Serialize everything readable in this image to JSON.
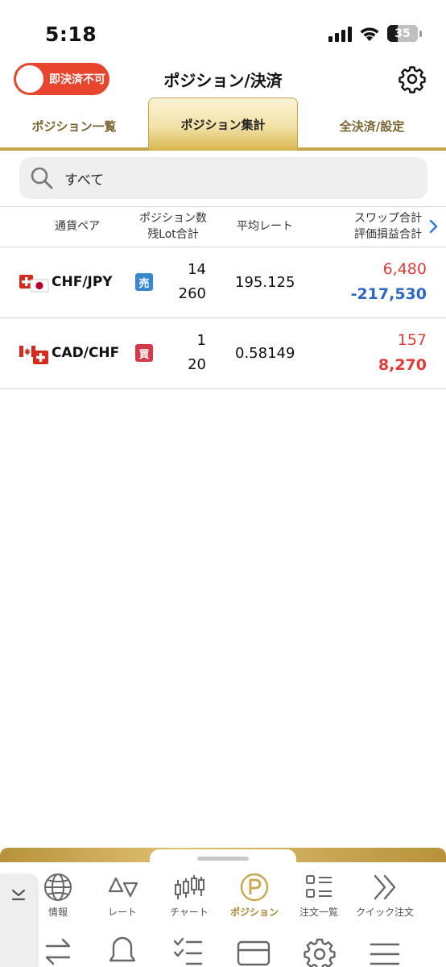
{
  "status_bar": {
    "time": "5:18",
    "battery": "35"
  },
  "header": {
    "toggle_label": "即決済不可",
    "title": "ポジション/決済"
  },
  "tabs": [
    {
      "label": "ポジション一覧",
      "active": false
    },
    {
      "label": "ポジション集計",
      "active": true
    },
    {
      "label": "全決済/設定",
      "active": false
    }
  ],
  "search": {
    "value": "すべて"
  },
  "table": {
    "headers": {
      "pair": "通貨ペア",
      "count_top": "ポジション数",
      "count_bottom": "残Lot合計",
      "rate": "平均レート",
      "swap_top": "スワップ合計",
      "swap_bottom": "評価損益合計"
    },
    "rows": [
      {
        "pair": "CHF/JPY",
        "side": "売",
        "side_color": "#3a87d0",
        "positions": "14",
        "lots": "260",
        "avg_rate": "195.125",
        "swap": "6,480",
        "swap_color": "#e23b36",
        "pnl": "-217,530",
        "pnl_color": "#2b66c9"
      },
      {
        "pair": "CAD/CHF",
        "side": "買",
        "side_color": "#d23a4a",
        "positions": "1",
        "lots": "20",
        "avg_rate": "0.58149",
        "swap": "157",
        "swap_color": "#e23b36",
        "pnl": "8,270",
        "pnl_color": "#e23b36"
      }
    ]
  },
  "bottom_nav": {
    "items": [
      {
        "label": "情報",
        "icon": "globe-icon"
      },
      {
        "label": "レート",
        "icon": "rate-arrows-icon"
      },
      {
        "label": "チャート",
        "icon": "candlestick-icon"
      },
      {
        "label": "ポジション",
        "icon": "position-p-icon",
        "active": true
      },
      {
        "label": "注文一覧",
        "icon": "order-list-icon"
      },
      {
        "label": "クイック注文",
        "icon": "double-chevron-icon"
      }
    ],
    "second_row_icons": [
      "exchange-icon",
      "bell-icon",
      "checklist-icon",
      "card-icon",
      "gear-icon",
      "menu-icon"
    ]
  },
  "colors": {
    "accent_gold": "#c9a64a",
    "toggle_red": "#e8452f"
  }
}
